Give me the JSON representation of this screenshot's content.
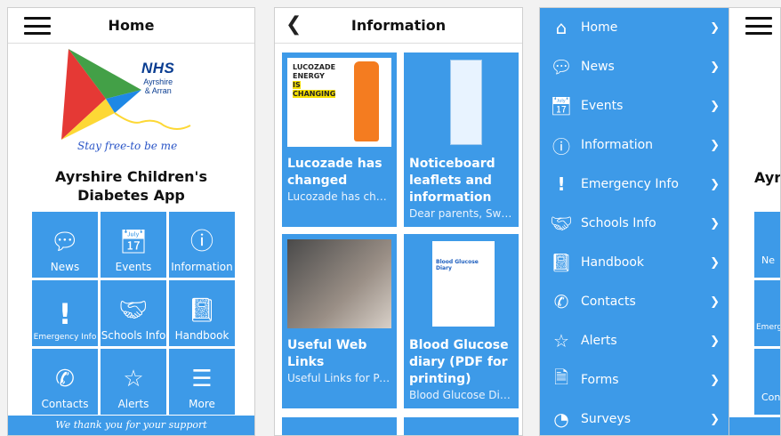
{
  "home": {
    "title": "Home",
    "logo_text": "NHS",
    "logo_sub1": "Ayrshire",
    "logo_sub2": "& Arran",
    "tagline": "Stay free-to be me",
    "app_name": "Ayrshire Children's Diabetes App",
    "tiles": [
      {
        "label": "News",
        "icon": "chat-bubble-icon"
      },
      {
        "label": "Events",
        "icon": "calendar-icon"
      },
      {
        "label": "Information",
        "icon": "info-icon"
      },
      {
        "label": "Emergency Info",
        "icon": "exclamation-icon"
      },
      {
        "label": "Schools Info",
        "icon": "handshake-icon"
      },
      {
        "label": "Handbook",
        "icon": "notebook-icon"
      },
      {
        "label": "Contacts",
        "icon": "phone-mail-icon"
      },
      {
        "label": "Alerts",
        "icon": "star-icon"
      },
      {
        "label": "More",
        "icon": "list-icon"
      }
    ],
    "footer": "We thank you for your support"
  },
  "information": {
    "title": "Information",
    "cards": [
      {
        "title": "Lucozade has changed",
        "desc": "Lucozade has changed it's formu...",
        "thumb_text1": "LUCOZADE ENERGY",
        "thumb_text2": "IS CHANGING"
      },
      {
        "title": "Noticeboard leaflets and information",
        "desc": "Dear parents, Swip..."
      },
      {
        "title": "Useful Web Links",
        "desc": " Useful Links for Personal Glucose..."
      },
      {
        "title": "Blood Glucose diary (PDF for printing)",
        "desc": "Blood Glucose Diary",
        "thumb_text1": "Blood Glucose Diary"
      }
    ]
  },
  "menu": {
    "items": [
      {
        "label": "Home",
        "icon": "home-icon"
      },
      {
        "label": "News",
        "icon": "chat-bubble-icon"
      },
      {
        "label": "Events",
        "icon": "calendar-icon"
      },
      {
        "label": "Information",
        "icon": "info-icon"
      },
      {
        "label": "Emergency Info",
        "icon": "exclamation-icon"
      },
      {
        "label": "Schools Info",
        "icon": "handshake-icon"
      },
      {
        "label": "Handbook",
        "icon": "notebook-icon"
      },
      {
        "label": "Contacts",
        "icon": "phone-mail-icon"
      },
      {
        "label": "Alerts",
        "icon": "star-icon"
      },
      {
        "label": "Forms",
        "icon": "forms-icon"
      },
      {
        "label": "Surveys",
        "icon": "surveys-icon"
      }
    ],
    "peek_title": "Ayrs",
    "peek_tiles": [
      "Ne",
      "Emerge",
      "Con"
    ]
  },
  "colors": {
    "accent": "#3d9ae8",
    "kite_red": "#e53935",
    "kite_green": "#43a047",
    "kite_blue": "#1e88e5",
    "kite_yellow": "#fdd835"
  }
}
